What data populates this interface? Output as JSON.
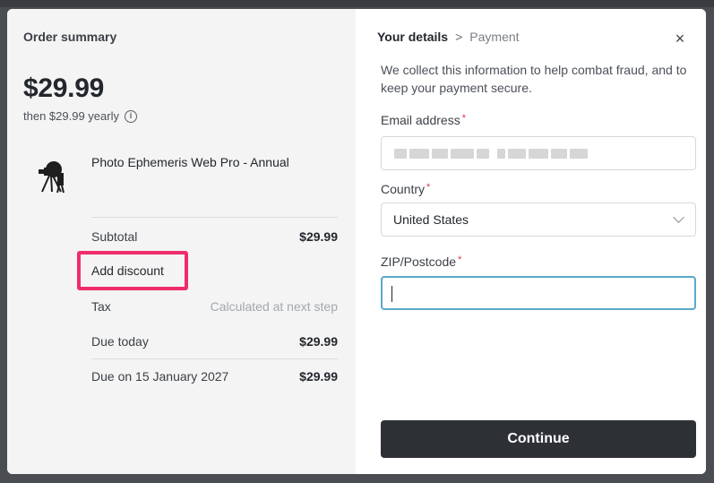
{
  "order_summary": {
    "title": "Order summary",
    "price": "$29.99",
    "recurrence": "then $29.99 yearly",
    "product_name": "Photo Ephemeris Web Pro - Annual",
    "subtotal_label": "Subtotal",
    "subtotal_value": "$29.99",
    "add_discount_label": "Add discount",
    "tax_label": "Tax",
    "tax_value": "Calculated at next step",
    "due_today_label": "Due today",
    "due_today_value": "$29.99",
    "due_on_label": "Due on 15 January 2027",
    "due_on_value": "$29.99",
    "highlight_color": "#ef2d6b"
  },
  "checkout": {
    "step_current": "Your details",
    "step_next": "Payment",
    "intro": "We collect this information to help combat fraud, and to keep your payment secure.",
    "email_label": "Email address",
    "country_label": "Country",
    "country_value": "United States",
    "zip_label": "ZIP/Postcode",
    "zip_value": "",
    "required_marker": "*",
    "continue_label": "Continue",
    "button_color": "#2d3035",
    "focus_color": "#5aa9c9"
  },
  "icons": {
    "info": "i",
    "close": "×",
    "breadcrumb_separator": ">"
  }
}
